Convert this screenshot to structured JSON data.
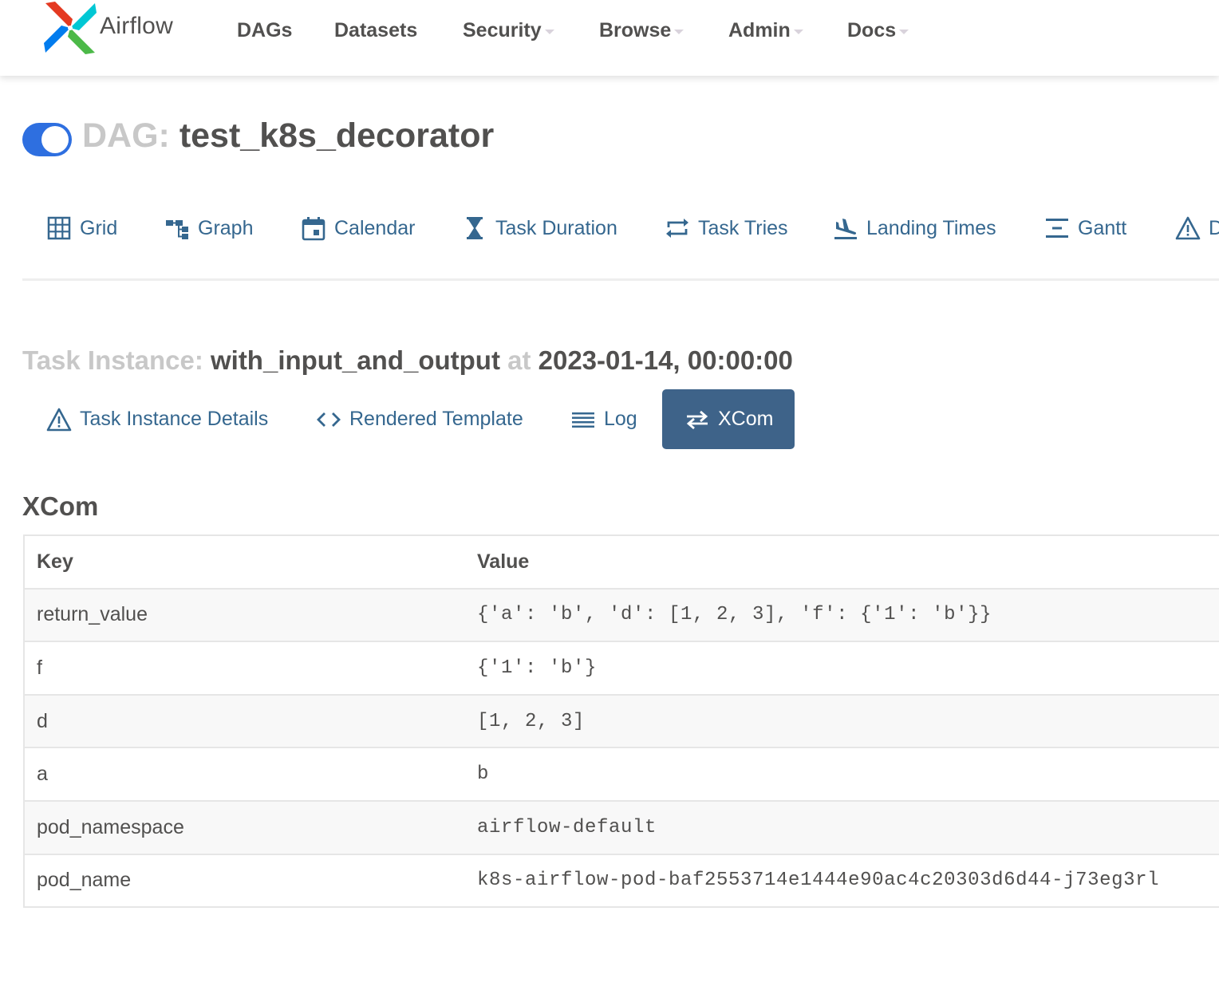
{
  "brand": {
    "name": "Airflow"
  },
  "nav": {
    "items": [
      {
        "label": "DAGs",
        "dropdown": false
      },
      {
        "label": "Datasets",
        "dropdown": false
      },
      {
        "label": "Security",
        "dropdown": true
      },
      {
        "label": "Browse",
        "dropdown": true
      },
      {
        "label": "Admin",
        "dropdown": true
      },
      {
        "label": "Docs",
        "dropdown": true
      }
    ]
  },
  "dag": {
    "paused": false,
    "prefix": "DAG:",
    "id": "test_k8s_decorator"
  },
  "view_tabs": [
    {
      "label": "Grid",
      "icon": "grid-icon"
    },
    {
      "label": "Graph",
      "icon": "graph-icon"
    },
    {
      "label": "Calendar",
      "icon": "calendar-icon"
    },
    {
      "label": "Task Duration",
      "icon": "hourglass-icon"
    },
    {
      "label": "Task Tries",
      "icon": "retry-icon"
    },
    {
      "label": "Landing Times",
      "icon": "plane-landing-icon"
    },
    {
      "label": "Gantt",
      "icon": "gantt-icon"
    },
    {
      "label": "D",
      "icon": "warning-triangle-icon"
    }
  ],
  "task_instance": {
    "prefix": "Task Instance:",
    "task_id": "with_input_and_output",
    "at_label": "at",
    "execution_date": "2023-01-14, 00:00:00",
    "tabs": [
      {
        "label": "Task Instance Details",
        "icon": "warning-triangle-icon",
        "active": false
      },
      {
        "label": "Rendered Template",
        "icon": "code-icon",
        "active": false
      },
      {
        "label": "Log",
        "icon": "list-lines-icon",
        "active": false
      },
      {
        "label": "XCom",
        "icon": "exchange-arrows-icon",
        "active": true
      }
    ]
  },
  "xcom": {
    "title": "XCom",
    "columns": {
      "key": "Key",
      "value": "Value"
    },
    "rows": [
      {
        "key": "return_value",
        "value": "{'a': 'b', 'd': [1, 2, 3], 'f': {'1': 'b'}}"
      },
      {
        "key": "f",
        "value": "{'1': 'b'}"
      },
      {
        "key": "d",
        "value": "[1, 2, 3]"
      },
      {
        "key": "a",
        "value": "b"
      },
      {
        "key": "pod_namespace",
        "value": "airflow-default"
      },
      {
        "key": "pod_name",
        "value": "k8s-airflow-pod-baf2553714e1444e90ac4c20303d6d44-j73eg3rl"
      }
    ]
  },
  "colors": {
    "link": "#35678f",
    "active_tab_bg": "#3e6389",
    "toggle_on": "#2e6fe0",
    "text": "#51504f",
    "muted": "#c8c8c8"
  }
}
